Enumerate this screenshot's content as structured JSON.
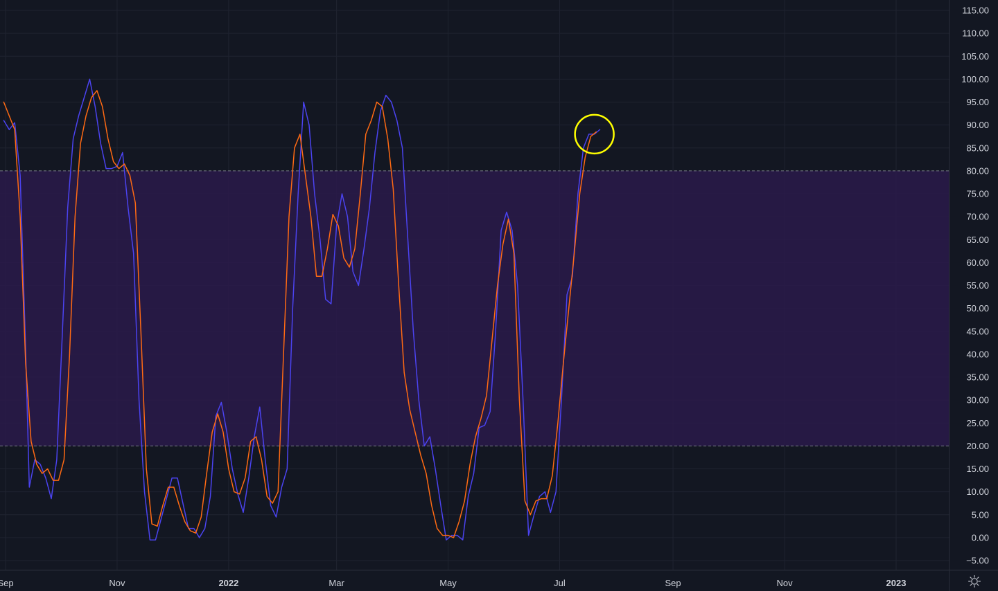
{
  "chart_data": {
    "type": "line",
    "title": "",
    "xlabel": "",
    "ylabel": "",
    "ylim": [
      -7,
      117
    ],
    "y_ticks": [
      115,
      110,
      105,
      100,
      95,
      90,
      85,
      80,
      75,
      70,
      65,
      60,
      55,
      50,
      45,
      40,
      35,
      30,
      25,
      20,
      15,
      10,
      5,
      0,
      -5
    ],
    "y_tick_labels": [
      "115.00",
      "110.00",
      "105.00",
      "100.00",
      "95.00",
      "90.00",
      "85.00",
      "80.00",
      "75.00",
      "70.00",
      "65.00",
      "60.00",
      "55.00",
      "50.00",
      "45.00",
      "40.00",
      "35.00",
      "30.00",
      "25.00",
      "20.00",
      "15.00",
      "10.00",
      "5.00",
      "0.00",
      "−5.00"
    ],
    "x_range": [
      "2021-09-01",
      "2023-01-31"
    ],
    "x_ticks": [
      {
        "date": "2021-09-01",
        "label": "Sep",
        "bold": false
      },
      {
        "date": "2021-11-01",
        "label": "Nov",
        "bold": false
      },
      {
        "date": "2022-01-01",
        "label": "2022",
        "bold": true
      },
      {
        "date": "2022-03-01",
        "label": "Mar",
        "bold": false
      },
      {
        "date": "2022-05-01",
        "label": "May",
        "bold": false
      },
      {
        "date": "2022-07-01",
        "label": "Jul",
        "bold": false
      },
      {
        "date": "2022-09-01",
        "label": "Sep",
        "bold": false
      },
      {
        "date": "2022-11-01",
        "label": "Nov",
        "bold": false
      },
      {
        "date": "2023-01-01",
        "label": "2023",
        "bold": true
      }
    ],
    "band": {
      "upper": 80,
      "lower": 20,
      "color": "#2a1a4a"
    },
    "grid": true,
    "colors": {
      "background": "#131722",
      "k_line": "#4b43f0",
      "d_line": "#ff6a13",
      "highlight": "#ffff00"
    },
    "series": [
      {
        "key": "k",
        "color": "#4b43f0",
        "points": [
          [
            "2021-08-31",
            91
          ],
          [
            "2021-09-03",
            89
          ],
          [
            "2021-09-06",
            90.5
          ],
          [
            "2021-09-09",
            79
          ],
          [
            "2021-09-12",
            41
          ],
          [
            "2021-09-14",
            11
          ],
          [
            "2021-09-17",
            17
          ],
          [
            "2021-09-20",
            16
          ],
          [
            "2021-09-23",
            13
          ],
          [
            "2021-09-26",
            8.5
          ],
          [
            "2021-09-29",
            17
          ],
          [
            "2021-10-02",
            44
          ],
          [
            "2021-10-05",
            72
          ],
          [
            "2021-10-08",
            87
          ],
          [
            "2021-10-11",
            92
          ],
          [
            "2021-10-14",
            96
          ],
          [
            "2021-10-17",
            100
          ],
          [
            "2021-10-20",
            94
          ],
          [
            "2021-10-23",
            86
          ],
          [
            "2021-10-26",
            80.5
          ],
          [
            "2021-10-29",
            80.5
          ],
          [
            "2021-11-01",
            81
          ],
          [
            "2021-11-04",
            84
          ],
          [
            "2021-11-07",
            72
          ],
          [
            "2021-11-10",
            62
          ],
          [
            "2021-11-13",
            30
          ],
          [
            "2021-11-16",
            10
          ],
          [
            "2021-11-19",
            -0.5
          ],
          [
            "2021-11-22",
            -0.5
          ],
          [
            "2021-11-25",
            4
          ],
          [
            "2021-11-28",
            8.5
          ],
          [
            "2021-12-01",
            13
          ],
          [
            "2021-12-04",
            13
          ],
          [
            "2021-12-07",
            7.5
          ],
          [
            "2021-12-10",
            2
          ],
          [
            "2021-12-13",
            2
          ],
          [
            "2021-12-16",
            0
          ],
          [
            "2021-12-19",
            2
          ],
          [
            "2021-12-22",
            9
          ],
          [
            "2021-12-25",
            26.5
          ],
          [
            "2021-12-28",
            29.5
          ],
          [
            "2021-12-31",
            23
          ],
          [
            "2022-01-03",
            15
          ],
          [
            "2022-01-06",
            9.5
          ],
          [
            "2022-01-09",
            5.5
          ],
          [
            "2022-01-12",
            13
          ],
          [
            "2022-01-15",
            22
          ],
          [
            "2022-01-18",
            28.5
          ],
          [
            "2022-01-21",
            17
          ],
          [
            "2022-01-24",
            7
          ],
          [
            "2022-01-27",
            4.5
          ],
          [
            "2022-01-30",
            11
          ],
          [
            "2022-02-02",
            15
          ],
          [
            "2022-02-05",
            50
          ],
          [
            "2022-02-08",
            75
          ],
          [
            "2022-02-11",
            95
          ],
          [
            "2022-02-14",
            90
          ],
          [
            "2022-02-17",
            75
          ],
          [
            "2022-02-20",
            65
          ],
          [
            "2022-02-23",
            52
          ],
          [
            "2022-02-26",
            51
          ],
          [
            "2022-03-01",
            68
          ],
          [
            "2022-03-04",
            75
          ],
          [
            "2022-03-07",
            70
          ],
          [
            "2022-03-10",
            58
          ],
          [
            "2022-03-13",
            55
          ],
          [
            "2022-03-16",
            63
          ],
          [
            "2022-03-19",
            72
          ],
          [
            "2022-03-22",
            84
          ],
          [
            "2022-03-25",
            93
          ],
          [
            "2022-03-28",
            96.5
          ],
          [
            "2022-03-31",
            95
          ],
          [
            "2022-04-03",
            91
          ],
          [
            "2022-04-06",
            85
          ],
          [
            "2022-04-09",
            65
          ],
          [
            "2022-04-12",
            45
          ],
          [
            "2022-04-15",
            30
          ],
          [
            "2022-04-18",
            20
          ],
          [
            "2022-04-21",
            22
          ],
          [
            "2022-04-24",
            15
          ],
          [
            "2022-04-27",
            7
          ],
          [
            "2022-04-30",
            -0.5
          ],
          [
            "2022-05-03",
            0.5
          ],
          [
            "2022-05-06",
            0.5
          ],
          [
            "2022-05-09",
            -0.5
          ],
          [
            "2022-05-12",
            9
          ],
          [
            "2022-05-15",
            14
          ],
          [
            "2022-05-18",
            24
          ],
          [
            "2022-05-21",
            24.5
          ],
          [
            "2022-05-24",
            27.5
          ],
          [
            "2022-05-27",
            45
          ],
          [
            "2022-05-30",
            67
          ],
          [
            "2022-06-02",
            71
          ],
          [
            "2022-06-05",
            67
          ],
          [
            "2022-06-08",
            55
          ],
          [
            "2022-06-11",
            30
          ],
          [
            "2022-06-14",
            0.5
          ],
          [
            "2022-06-17",
            5
          ],
          [
            "2022-06-20",
            9
          ],
          [
            "2022-06-23",
            10
          ],
          [
            "2022-06-26",
            5.5
          ],
          [
            "2022-06-29",
            10
          ],
          [
            "2022-07-02",
            30
          ],
          [
            "2022-07-05",
            53
          ],
          [
            "2022-07-08",
            57
          ],
          [
            "2022-07-11",
            75
          ],
          [
            "2022-07-14",
            85
          ],
          [
            "2022-07-17",
            88
          ],
          [
            "2022-07-20",
            88
          ],
          [
            "2022-07-23",
            89
          ]
        ]
      },
      {
        "key": "d",
        "color": "#ff6a13",
        "points": [
          [
            "2021-08-31",
            95
          ],
          [
            "2021-09-03",
            92
          ],
          [
            "2021-09-06",
            89
          ],
          [
            "2021-09-09",
            70
          ],
          [
            "2021-09-12",
            38
          ],
          [
            "2021-09-15",
            21
          ],
          [
            "2021-09-18",
            16
          ],
          [
            "2021-09-21",
            14
          ],
          [
            "2021-09-24",
            15
          ],
          [
            "2021-09-27",
            12.5
          ],
          [
            "2021-09-30",
            12.5
          ],
          [
            "2021-10-03",
            17
          ],
          [
            "2021-10-06",
            40
          ],
          [
            "2021-10-09",
            70
          ],
          [
            "2021-10-12",
            86
          ],
          [
            "2021-10-15",
            92
          ],
          [
            "2021-10-18",
            96
          ],
          [
            "2021-10-21",
            97.5
          ],
          [
            "2021-10-24",
            94
          ],
          [
            "2021-10-27",
            87
          ],
          [
            "2021-10-30",
            82
          ],
          [
            "2021-11-02",
            80.5
          ],
          [
            "2021-11-05",
            81.5
          ],
          [
            "2021-11-08",
            79
          ],
          [
            "2021-11-11",
            73
          ],
          [
            "2021-11-14",
            45
          ],
          [
            "2021-11-17",
            15
          ],
          [
            "2021-11-20",
            3
          ],
          [
            "2021-11-23",
            2.5
          ],
          [
            "2021-11-26",
            7
          ],
          [
            "2021-11-29",
            11
          ],
          [
            "2021-12-02",
            11
          ],
          [
            "2021-12-05",
            7
          ],
          [
            "2021-12-08",
            3.5
          ],
          [
            "2021-12-11",
            1.5
          ],
          [
            "2021-12-14",
            1
          ],
          [
            "2021-12-17",
            4.5
          ],
          [
            "2021-12-20",
            14
          ],
          [
            "2021-12-23",
            23
          ],
          [
            "2021-12-26",
            27
          ],
          [
            "2021-12-29",
            23
          ],
          [
            "2022-01-01",
            15
          ],
          [
            "2022-01-04",
            10
          ],
          [
            "2022-01-07",
            9.5
          ],
          [
            "2022-01-10",
            13
          ],
          [
            "2022-01-13",
            21
          ],
          [
            "2022-01-16",
            22
          ],
          [
            "2022-01-19",
            17
          ],
          [
            "2022-01-22",
            9
          ],
          [
            "2022-01-25",
            7.5
          ],
          [
            "2022-01-28",
            10
          ],
          [
            "2022-01-31",
            40
          ],
          [
            "2022-02-03",
            70
          ],
          [
            "2022-02-06",
            85
          ],
          [
            "2022-02-09",
            88
          ],
          [
            "2022-02-12",
            79
          ],
          [
            "2022-02-15",
            70
          ],
          [
            "2022-02-18",
            57
          ],
          [
            "2022-02-21",
            57
          ],
          [
            "2022-02-24",
            63
          ],
          [
            "2022-02-27",
            70.5
          ],
          [
            "2022-03-02",
            68
          ],
          [
            "2022-03-05",
            61
          ],
          [
            "2022-03-08",
            59
          ],
          [
            "2022-03-11",
            63
          ],
          [
            "2022-03-14",
            75
          ],
          [
            "2022-03-17",
            88
          ],
          [
            "2022-03-20",
            91
          ],
          [
            "2022-03-23",
            95
          ],
          [
            "2022-03-26",
            94
          ],
          [
            "2022-03-29",
            87
          ],
          [
            "2022-04-01",
            76
          ],
          [
            "2022-04-04",
            55
          ],
          [
            "2022-04-07",
            36
          ],
          [
            "2022-04-10",
            28
          ],
          [
            "2022-04-13",
            23
          ],
          [
            "2022-04-16",
            18
          ],
          [
            "2022-04-19",
            14
          ],
          [
            "2022-04-22",
            7
          ],
          [
            "2022-04-25",
            2
          ],
          [
            "2022-04-28",
            0.5
          ],
          [
            "2022-05-01",
            0.5
          ],
          [
            "2022-05-04",
            0
          ],
          [
            "2022-05-07",
            3.5
          ],
          [
            "2022-05-10",
            8
          ],
          [
            "2022-05-13",
            16
          ],
          [
            "2022-05-16",
            22
          ],
          [
            "2022-05-19",
            26
          ],
          [
            "2022-05-22",
            31
          ],
          [
            "2022-05-25",
            43
          ],
          [
            "2022-05-28",
            55
          ],
          [
            "2022-05-31",
            64
          ],
          [
            "2022-06-03",
            69.5
          ],
          [
            "2022-06-06",
            62
          ],
          [
            "2022-06-09",
            30
          ],
          [
            "2022-06-12",
            8
          ],
          [
            "2022-06-15",
            5
          ],
          [
            "2022-06-18",
            8
          ],
          [
            "2022-06-21",
            8.5
          ],
          [
            "2022-06-24",
            8.5
          ],
          [
            "2022-06-27",
            13.5
          ],
          [
            "2022-06-30",
            25
          ],
          [
            "2022-07-03",
            38
          ],
          [
            "2022-07-06",
            50
          ],
          [
            "2022-07-09",
            62
          ],
          [
            "2022-07-12",
            75
          ],
          [
            "2022-07-15",
            83
          ],
          [
            "2022-07-18",
            87.5
          ],
          [
            "2022-07-21",
            88.5
          ]
        ]
      }
    ],
    "annotations": [
      {
        "type": "circle",
        "date": "2022-07-20",
        "value": 88,
        "color": "#ffff00"
      }
    ]
  }
}
